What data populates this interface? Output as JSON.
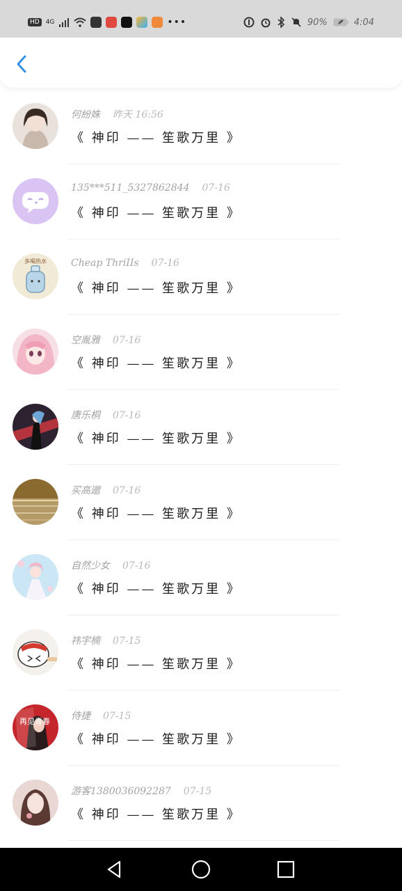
{
  "status_bar": {
    "network": "HD",
    "signal": "4G",
    "battery": "90%",
    "time": "4:04"
  },
  "messages": [
    {
      "name": "何紛姝",
      "time": "昨天 16:56",
      "text": "《 神印 —— 笙歌万里 》",
      "avatar": "portrait-girl",
      "colors": [
        "#e9e1db",
        "#3a2a24"
      ]
    },
    {
      "name": "135***511_5327862844",
      "time": "07-16",
      "text": "《 神印 —— 笙歌万里 》",
      "avatar": "default-chat",
      "colors": [
        "#d9c4f3",
        "#ffffff"
      ]
    },
    {
      "name": "Cheap ThriIIs",
      "time": "07-16",
      "text": "《 神印 —— 笙歌万里 》",
      "avatar": "cartoon-bottle",
      "colors": [
        "#f1ead6",
        "#b9d6e8"
      ]
    },
    {
      "name": "空胤雅",
      "time": "07-16",
      "text": "《 神印 —— 笙歌万里 》",
      "avatar": "anime-pink-hair",
      "colors": [
        "#f3b6c6",
        "#7a3d55"
      ]
    },
    {
      "name": "唐乐桐",
      "time": "07-16",
      "text": "《 神印 —— 笙歌万里 》",
      "avatar": "anime-dark-red",
      "colors": [
        "#2c2230",
        "#b3343c"
      ]
    },
    {
      "name": "买高邈",
      "time": "07-16",
      "text": "《 神印 —— 笙歌万里 》",
      "avatar": "sunset-sea",
      "colors": [
        "#8a6a2f",
        "#d7c39a"
      ]
    },
    {
      "name": "自然少女",
      "time": "07-16",
      "text": "《 神印 —— 笙歌万里 》",
      "avatar": "anime-girl-blue",
      "colors": [
        "#cbe6f5",
        "#f0b8c8"
      ]
    },
    {
      "name": "祎宇楠",
      "time": "07-15",
      "text": "《 神印 —— 笙歌万里 》",
      "avatar": "cartoon-crying",
      "colors": [
        "#f4f1ec",
        "#d23b2d"
      ]
    },
    {
      "name": "侍捷",
      "time": "07-15",
      "text": "《 神印 —— 笙歌万里 》",
      "avatar": "red-poster",
      "colors": [
        "#c4262b",
        "#2a1c1c"
      ]
    },
    {
      "name": "游客1380036092287",
      "time": "07-15",
      "text": "《 神印 —— 笙歌万里 》",
      "avatar": "portrait-woman",
      "colors": [
        "#e8d7d3",
        "#5b3a33"
      ]
    }
  ],
  "avatar_overlay_text": {
    "cartoon-bottle": "多喝热水",
    "red-poster": "再见青春"
  }
}
